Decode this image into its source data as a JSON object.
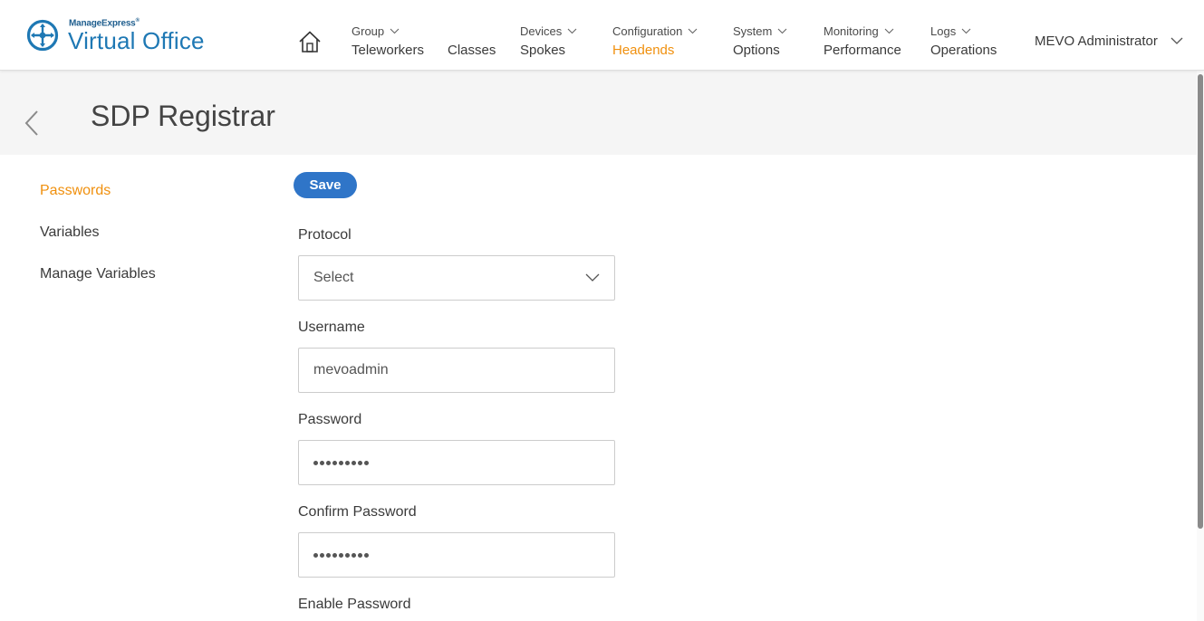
{
  "brand": {
    "small": "ManageExpress",
    "reg": "®",
    "name": "Virtual Office"
  },
  "nav": {
    "home_icon": "home-icon",
    "items": [
      {
        "sup": "Group",
        "main": "Teleworkers"
      },
      {
        "main": "Classes"
      },
      {
        "sup": "Devices",
        "main": "Spokes"
      },
      {
        "sup": "Configuration",
        "main": "Headends",
        "active": true
      },
      {
        "sup": "System",
        "main": "Options"
      },
      {
        "sup": "Monitoring",
        "main": "Performance"
      },
      {
        "sup": "Logs",
        "main": "Operations"
      }
    ],
    "user": "MEVO Administrator"
  },
  "page": {
    "title": "SDP Registrar"
  },
  "sidebar": {
    "items": [
      {
        "label": "Passwords",
        "active": true
      },
      {
        "label": "Variables"
      },
      {
        "label": "Manage Variables"
      }
    ]
  },
  "form": {
    "save_label": "Save",
    "protocol": {
      "label": "Protocol",
      "value": "Select"
    },
    "username": {
      "label": "Username",
      "value": "mevoadmin"
    },
    "password": {
      "label": "Password",
      "masked_length": 9
    },
    "confirm_password": {
      "label": "Confirm Password",
      "masked_length": 9
    },
    "enable_password": {
      "label": "Enable Password"
    }
  },
  "colors": {
    "accent": "#f0900e",
    "primary": "#2f75c8",
    "brand": "#1e78b4"
  }
}
